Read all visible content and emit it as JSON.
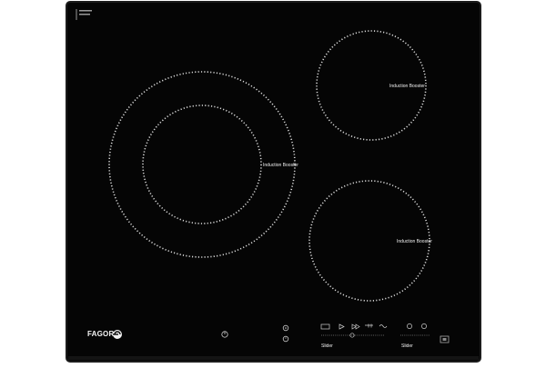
{
  "brand": {
    "name": "FAGOR"
  },
  "corner_mark": "",
  "zones": [
    {
      "label": "Induction Booster"
    },
    {
      "label": "Induction Booster"
    },
    {
      "label": "Induction Booster"
    }
  ],
  "controls": {
    "slider_left_label": "Slider",
    "slider_right_label": "Slider"
  },
  "colors": {
    "glass": "#050505",
    "frame": "#1c1c1c",
    "ring": "#d9d9d9",
    "text": "#f2f2f2"
  }
}
